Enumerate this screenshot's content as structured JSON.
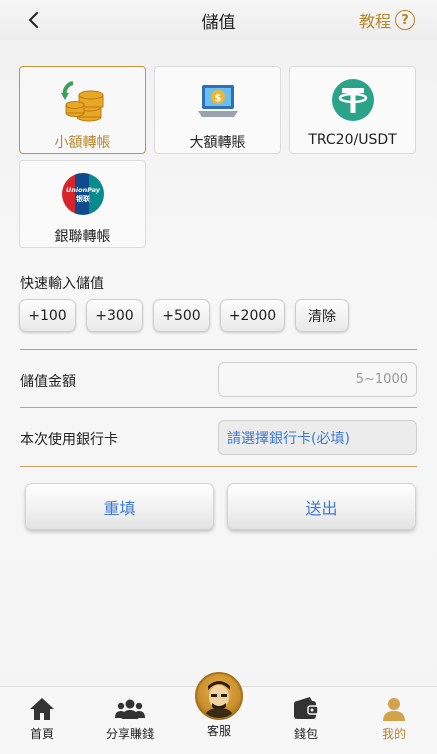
{
  "header": {
    "title": "儲值",
    "tutorial_label": "教程"
  },
  "methods": [
    {
      "label": "小額轉帳",
      "icon": "coins-icon",
      "active": true
    },
    {
      "label": "大額轉賬",
      "icon": "laptop-dollar-icon",
      "active": false
    },
    {
      "label": "TRC20/USDT",
      "icon": "tether-icon",
      "active": false
    },
    {
      "label": "銀聯轉帳",
      "icon": "unionpay-icon",
      "active": false
    }
  ],
  "unionpay_logo": {
    "line1": "UnionPay",
    "line2": "银联"
  },
  "quick": {
    "label": "快速輸入儲值",
    "chips": [
      "+100",
      "+300",
      "+500",
      "+2000",
      "清除"
    ]
  },
  "form": {
    "amount_label": "儲值金額",
    "amount_placeholder": "5~1000",
    "card_label": "本次使用銀行卡",
    "card_value": "請選擇銀行卡(必填)"
  },
  "actions": {
    "reset_label": "重填",
    "submit_label": "送出"
  },
  "tabbar": {
    "items": [
      {
        "label": "首頁",
        "icon": "home-icon",
        "active": false
      },
      {
        "label": "分享賺錢",
        "icon": "people-icon",
        "active": false
      },
      {
        "label": "客服",
        "icon": "customer-service-avatar-icon",
        "active": false
      },
      {
        "label": "錢包",
        "icon": "wallet-icon",
        "active": false
      },
      {
        "label": "我的",
        "icon": "user-icon",
        "active": true
      }
    ]
  },
  "colors": {
    "accent_gold": "#b8862c",
    "link_blue": "#3d7ad8",
    "divider": "#c9a063"
  }
}
